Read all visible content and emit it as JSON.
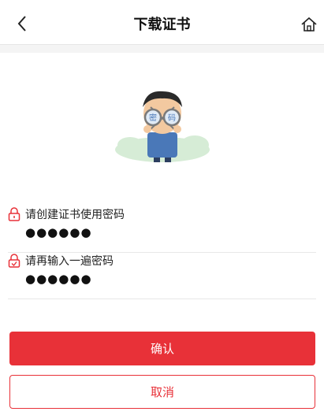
{
  "header": {
    "title": "下载证书"
  },
  "illustration": {
    "lens_left_text": "密",
    "lens_right_text": "码"
  },
  "fields": [
    {
      "label": "请创建证书使用密码",
      "value": "●●●●●●"
    },
    {
      "label": "请再输入一遍密码",
      "value": "●●●●●●"
    }
  ],
  "buttons": {
    "confirm_label": "确认",
    "cancel_label": "取消"
  },
  "colors": {
    "accent": "#e83138",
    "divider": "#e8e8e8"
  },
  "icons": {
    "back": "chevron-left-icon",
    "home": "home-icon",
    "field1": "lock-icon",
    "field2": "lock-check-icon"
  }
}
